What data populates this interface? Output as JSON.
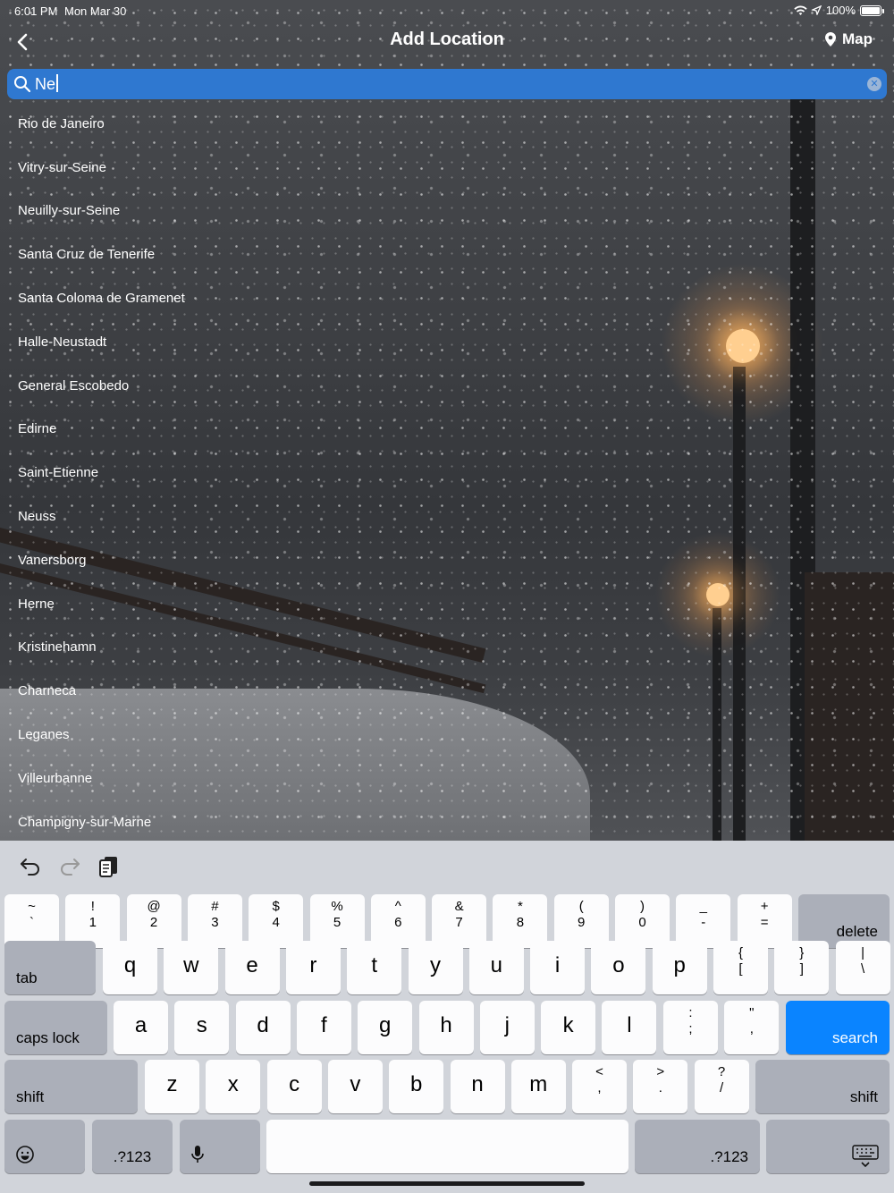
{
  "status_bar": {
    "time": "6:01 PM",
    "date": "Mon Mar 30",
    "battery": "100%"
  },
  "nav": {
    "title": "Add Location",
    "map_label": "Map"
  },
  "search": {
    "value": "Ne"
  },
  "results": [
    "Rio de Janeiro",
    "Vitry-sur-Seine",
    "Neuilly-sur-Seine",
    "Santa Cruz de Tenerife",
    "Santa Coloma de Gramenet",
    "Halle-Neustadt",
    "General Escobedo",
    "Edirne",
    "Saint-Etienne",
    "Neuss",
    "Vanersborg",
    "Herne",
    "Kristinehamn",
    "Charneca",
    "Leganes",
    "Villeurbanne",
    "Champigny-sur-Marne"
  ],
  "keyboard": {
    "row1": [
      {
        "top": "~",
        "bottom": "`"
      },
      {
        "top": "!",
        "bottom": "1"
      },
      {
        "top": "@",
        "bottom": "2"
      },
      {
        "top": "#",
        "bottom": "3"
      },
      {
        "top": "$",
        "bottom": "4"
      },
      {
        "top": "%",
        "bottom": "5"
      },
      {
        "top": "^",
        "bottom": "6"
      },
      {
        "top": "&",
        "bottom": "7"
      },
      {
        "top": "*",
        "bottom": "8"
      },
      {
        "top": "(",
        "bottom": "9"
      },
      {
        "top": ")",
        "bottom": "0"
      },
      {
        "top": "_",
        "bottom": "-"
      },
      {
        "top": "+",
        "bottom": "="
      }
    ],
    "delete": "delete",
    "tab": "tab",
    "row2": [
      "q",
      "w",
      "e",
      "r",
      "t",
      "y",
      "u",
      "i",
      "o",
      "p"
    ],
    "row2_sym": [
      {
        "top": "{",
        "bottom": "["
      },
      {
        "top": "}",
        "bottom": "]"
      },
      {
        "top": "|",
        "bottom": "\\"
      }
    ],
    "caps_lock": "caps lock",
    "row3": [
      "a",
      "s",
      "d",
      "f",
      "g",
      "h",
      "j",
      "k",
      "l"
    ],
    "row3_sym": [
      {
        "top": ":",
        "bottom": ";"
      },
      {
        "top": "\"",
        "bottom": ","
      }
    ],
    "search": "search",
    "shift": "shift",
    "row4": [
      "z",
      "x",
      "c",
      "v",
      "b",
      "n",
      "m"
    ],
    "row4_sym": [
      {
        "top": "<",
        "bottom": ","
      },
      {
        "top": ">",
        "bottom": "."
      },
      {
        "top": "?",
        "bottom": "/"
      }
    ],
    "numbers": ".?123"
  }
}
